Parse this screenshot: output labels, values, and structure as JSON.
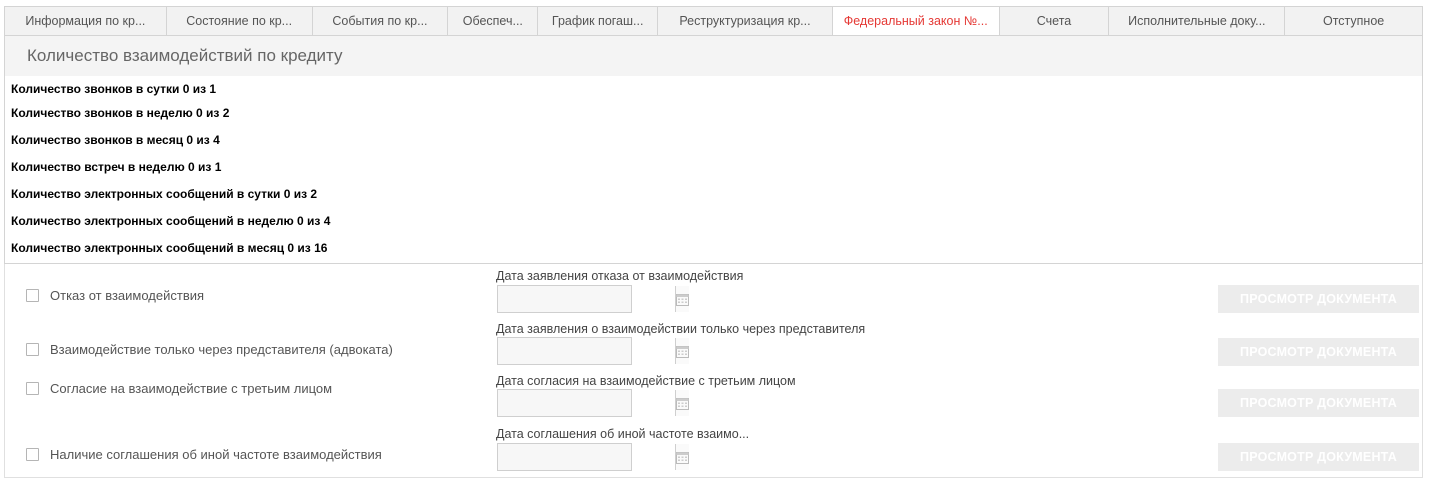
{
  "tabs": [
    {
      "label": "Информация по кр..."
    },
    {
      "label": "Состояние по кр..."
    },
    {
      "label": "События по кр..."
    },
    {
      "label": "Обеспеч..."
    },
    {
      "label": "График погаш..."
    },
    {
      "label": "Реструктуризация кр..."
    },
    {
      "label": "Федеральный закон №..."
    },
    {
      "label": "Счета"
    },
    {
      "label": "Исполнительные доку..."
    },
    {
      "label": "Отступное"
    }
  ],
  "active_tab_color": "#e53935",
  "panel": {
    "title": "Количество взаимодействий по кредиту",
    "stats": [
      "Количество звонков в сутки 0 из 1",
      "Количество звонков в неделю 0 из 2",
      "Количество звонков в месяц 0 из 4",
      "Количество встреч в неделю 0 из 1",
      "Количество электронных сообщений в сутки 0 из 2",
      "Количество электронных сообщений в неделю 0 из 4",
      "Количество электронных сообщений в месяц 0 из 16"
    ]
  },
  "options": [
    {
      "checkbox_label": "Отказ от взаимодействия",
      "date_label": "Дата заявления отказа от взаимодействия",
      "date_value": "",
      "button_label": "ПРОСМОТР ДОКУМЕНТА"
    },
    {
      "checkbox_label": "Взаимодействие только через представителя (адвоката)",
      "date_label": "Дата заявления о взаимодействии только через представителя",
      "date_value": "",
      "button_label": "ПРОСМОТР ДОКУМЕНТА"
    },
    {
      "checkbox_label": "Согласие на взаимодействие с третьим лицом",
      "date_label": "Дата согласия на взаимодействие с третьим лицом",
      "date_value": "",
      "button_label": "ПРОСМОТР ДОКУМЕНТА"
    },
    {
      "checkbox_label": "Наличие соглашения об иной частоте взаимодействия",
      "date_label": "Дата соглашения об иной частоте взаимо...",
      "date_value": "",
      "button_label": "ПРОСМОТР ДОКУМЕНТА"
    }
  ],
  "icons": {
    "calendar": "calendar-icon"
  }
}
